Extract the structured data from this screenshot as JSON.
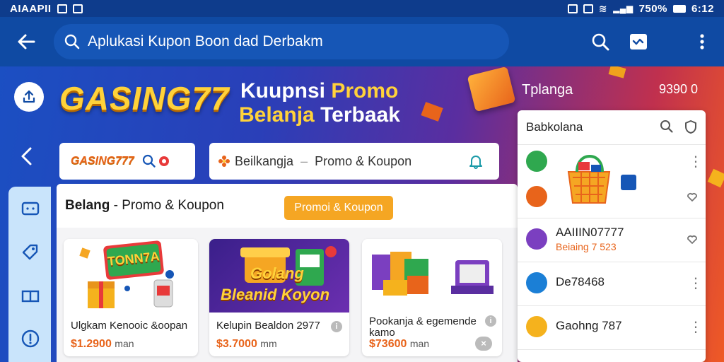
{
  "status_bar": {
    "left_text": "AIAAPII",
    "right_text": "750%",
    "time": "6:12"
  },
  "app_bar": {
    "search_text": "Aplukasi Kupon Boon dad Derbakm"
  },
  "hero": {
    "brand": "GASING77",
    "promo_line1_a": "Kuupnsi",
    "promo_line1_b": "Promo",
    "promo_line2_a": "Belanja",
    "promo_line2_b": "Terbaak",
    "side_label": "Tplanga",
    "side_number": "9390 0",
    "chip1_logo": "GASING777",
    "chip2_a": "Beilkangja",
    "chip2_b": "Promo & Koupon"
  },
  "main": {
    "title_bold": "Belang",
    "title_rest": " - Promo & Koupon",
    "button_label": "Promoi & Koupon",
    "products": [
      {
        "name": "Ulgkam Kenooic &oopan",
        "price": "$1.2900",
        "unit": "man",
        "image_text": "TONN7A"
      },
      {
        "name": "Kelupin Bealdon 2977",
        "price": "$3.7000",
        "unit": "mm",
        "image_text_1": "Golang",
        "image_text_2": "Bleanid Koyon"
      },
      {
        "name_line1": "Pookanja & egemende",
        "name_line2": "kamo",
        "price": "$73600",
        "unit": "man"
      }
    ]
  },
  "right_panel": {
    "title": "Babkolana",
    "rows": [
      {
        "name": "AAIIIN07777",
        "sub": "Beiaing 7 523"
      },
      {
        "name": "De78468"
      },
      {
        "name": "Gaohng 787"
      }
    ]
  },
  "colors": {
    "app_bar": "#0f4aa3",
    "accent_orange": "#f5a623",
    "brand_yellow": "#ffd23a",
    "price_orange": "#e8641b"
  }
}
